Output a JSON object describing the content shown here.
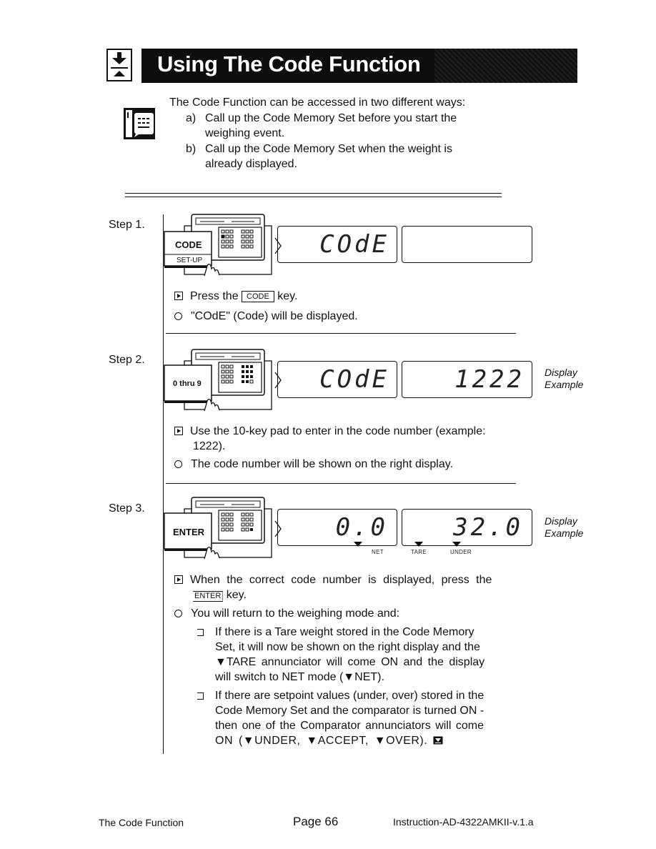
{
  "header": {
    "icon": "down-up-arrows-icon",
    "title": "Using The Code Function"
  },
  "intro": {
    "icon": "speech-bubble-note-icon",
    "lead": "The Code Function can be accessed in two different ways:",
    "options": [
      {
        "marker": "a)",
        "line1": "Call up the Code Memory Set before you start the",
        "line2": "weighing event."
      },
      {
        "marker": "b)",
        "line1": "Call up the Code Memory Set when the weight is",
        "line2": "already displayed."
      }
    ]
  },
  "steps": [
    {
      "label": "Step 1.",
      "key_label": "CODE",
      "key_sublabel": "SET-UP",
      "left_display": "COdE",
      "right_display": "",
      "action_pre": "Press the",
      "action_key": "CODE",
      "action_post": "key.",
      "result": "\"COdE\" (Code) will be displayed."
    },
    {
      "label": "Step 2.",
      "key_label": "0 thru 9",
      "left_display": "COdE",
      "right_display": "1222",
      "display_note_1": "Display",
      "display_note_2": "Example",
      "action_line1": "Use the 10-key pad to enter in the code number (example:",
      "action_line2": "1222).",
      "result": "The code number will be shown on the right display."
    },
    {
      "label": "Step 3.",
      "key_label": "ENTER",
      "left_display": "0.0",
      "right_display": "32.0",
      "display_note_1": "Display",
      "display_note_2": "Example",
      "annunciators": [
        "NET",
        "TARE",
        "UNDER"
      ],
      "action_line1": "When the correct code number is displayed, press the",
      "action_key": "ENTER",
      "action_post": "key.",
      "result": "You will return to the weighing mode and:",
      "sub_items": [
        {
          "lines": [
            "If there is a Tare weight stored in the Code Memory",
            "Set, it will now be shown on the right display and the",
            "▼TARE annunciator will come ON and the display",
            "will switch to NET mode (▼NET)."
          ]
        },
        {
          "lines": [
            "If there are setpoint values (under, over) stored in the",
            "Code Memory Set and the comparator is turned ON -",
            "then one of the Comparator annunciators will come",
            "ON (▼UNDER, ▼ACCEPT, ▼OVER)."
          ],
          "end_icon": "section-end-icon"
        }
      ]
    }
  ],
  "footer": {
    "section": "The Code Function",
    "page": "Page 66",
    "doc_id": "Instruction-AD-4322AMKII-v.1.a"
  }
}
